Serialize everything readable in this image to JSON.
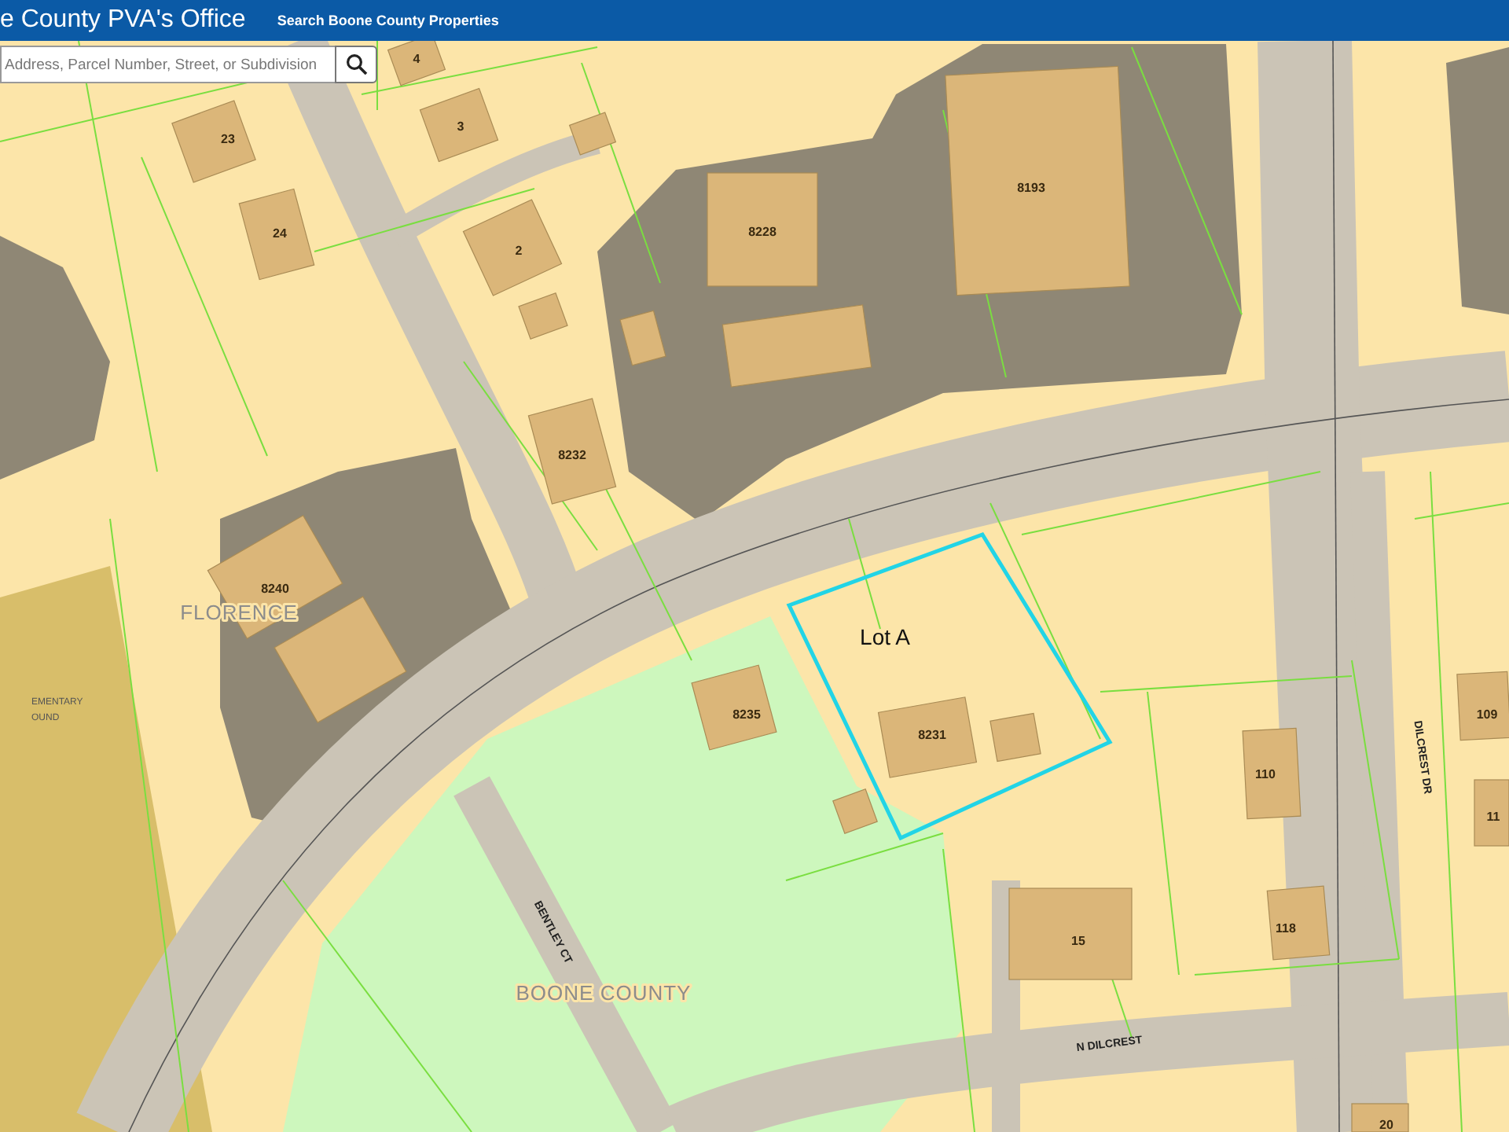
{
  "header": {
    "title": "e County PVA's Office",
    "nav_link": "Search Boone County Properties"
  },
  "search": {
    "placeholder": "Address, Parcel Number, Street, or Subdivision"
  },
  "map": {
    "parcel_numbers": [
      "4",
      "23",
      "3",
      "24",
      "2",
      "8228",
      "8193",
      "8232",
      "8240",
      "8235",
      "8231",
      "110",
      "109",
      "11",
      "118",
      "15",
      "20"
    ],
    "place_labels": [
      {
        "text": "FLORENCE",
        "kind": "city"
      },
      {
        "text": "BOONE COUNTY",
        "kind": "city"
      },
      {
        "text": "EMENTARY",
        "kind": "facility"
      },
      {
        "text": "OUND",
        "kind": "facility"
      }
    ],
    "street_labels": [
      "BENTLEY CT",
      "DILCREST DR",
      "N DILCREST"
    ],
    "selected_parcel": {
      "label": "Lot A",
      "selected": true
    }
  }
}
